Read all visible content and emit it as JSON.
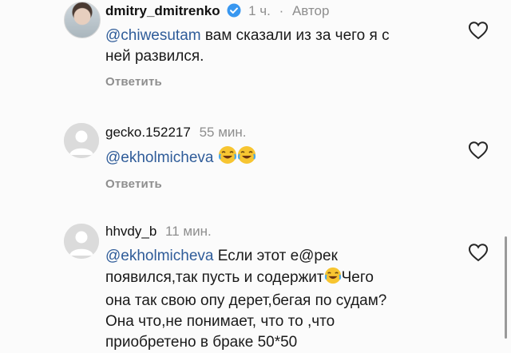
{
  "comments": [
    {
      "username": "dmitry_dmitrenko",
      "verified": true,
      "time": "1 ч.",
      "separator": "·",
      "author_label": "Автор",
      "mention": "@chiwesutam",
      "text_after": " вам сказали из за чего я с",
      "line2": "ней развился.",
      "reply_label": "Ответить"
    },
    {
      "username": "gecko.152217",
      "time": "55 мин.",
      "mention": "@ekholmicheva",
      "emoji": "face-with-tears-of-joy",
      "reply_label": "Ответить"
    },
    {
      "username": "hhvdy_b",
      "time": "11 мин.",
      "mention": "@ekholmicheva",
      "line1_rest": " Если этот е@рек",
      "line2_a": "появился,так пусть и содержит",
      "line2_b": "Чего",
      "line3": "она так свою опу дерет,бегая по судам?",
      "line4": "Она что,не понимает, что то ,что",
      "line5": "приобретено в браке 50*50"
    }
  ],
  "colors": {
    "mention": "#2f5c99",
    "meta": "#8e8e8e",
    "verified": "#3897f0"
  },
  "icons": [
    "heart-icon",
    "verified-badge-icon",
    "default-avatar-icon",
    "laughing-emoji-icon"
  ]
}
